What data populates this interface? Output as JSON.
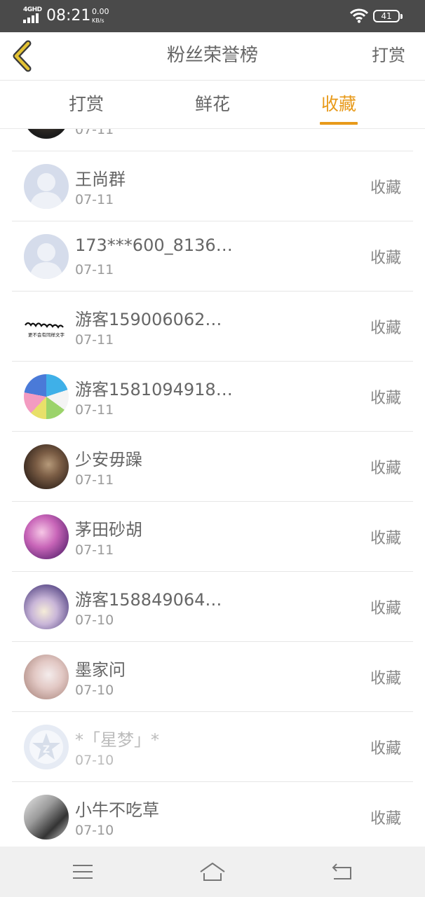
{
  "status_bar": {
    "network": "4GHD",
    "time": "08:21",
    "speed_value": "0.00",
    "speed_unit": "KB/s",
    "battery": "41"
  },
  "header": {
    "title": "粉丝荣誉榜",
    "action_label": "打赏"
  },
  "tabs": [
    {
      "label": "打赏",
      "active": false
    },
    {
      "label": "鲜花",
      "active": false
    },
    {
      "label": "收藏",
      "active": true
    }
  ],
  "accent_color": "#e89a1a",
  "partial_row": {
    "date": "07-11"
  },
  "rows": [
    {
      "name": "王尚群",
      "date": "07-11",
      "type": "收藏",
      "avatar": "default-user"
    },
    {
      "name": "173***600_8136…",
      "date": "07-11",
      "type": "收藏",
      "avatar": "default-user"
    },
    {
      "name": "游客159006062…",
      "date": "07-11",
      "type": "收藏",
      "avatar": "calligraphy-image",
      "avatar_caption": "更不会有同样文字"
    },
    {
      "name": "游客1581094918…",
      "date": "07-11",
      "type": "收藏",
      "avatar": "anime-image"
    },
    {
      "name": "少安毋躁",
      "date": "07-11",
      "type": "收藏",
      "avatar": "photo-image"
    },
    {
      "name": "茅田砂胡",
      "date": "07-11",
      "type": "收藏",
      "avatar": "anime-image"
    },
    {
      "name": "游客158849064…",
      "date": "07-10",
      "type": "收藏",
      "avatar": "anime-image"
    },
    {
      "name": "墨家问",
      "date": "07-10",
      "type": "收藏",
      "avatar": "anime-image"
    },
    {
      "name": "*「星梦」*",
      "date": "07-10",
      "type": "收藏",
      "avatar": "qq-logo",
      "faded": true
    },
    {
      "name": "小牛不吃草",
      "date": "07-10",
      "type": "收藏",
      "avatar": "bw-photo"
    }
  ],
  "nav_bar": {
    "menu_icon": "menu-icon",
    "home_icon": "home-icon",
    "back_icon": "back-icon"
  }
}
